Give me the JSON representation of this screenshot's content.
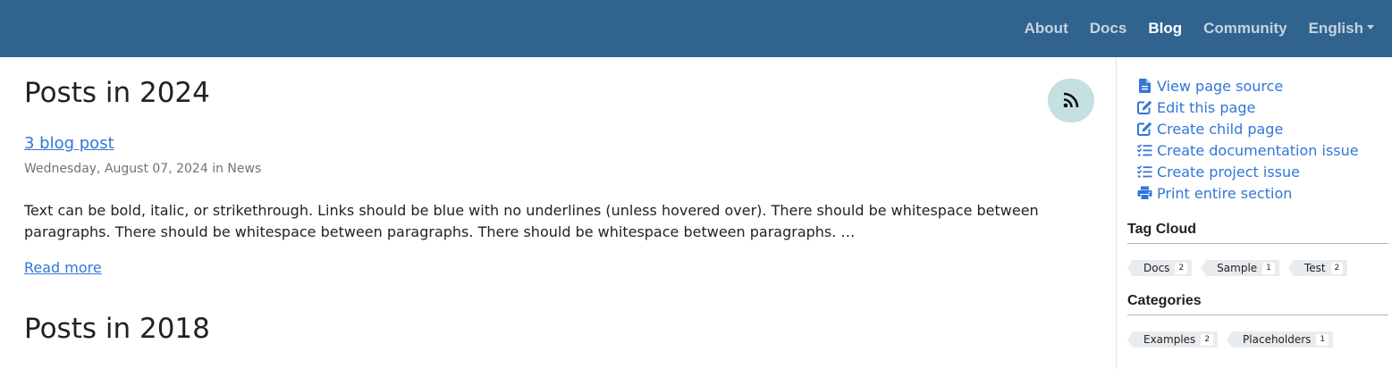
{
  "navbar": {
    "links": [
      {
        "label": "About",
        "active": false
      },
      {
        "label": "Docs",
        "active": false
      },
      {
        "label": "Blog",
        "active": true
      },
      {
        "label": "Community",
        "active": false
      }
    ],
    "language": "English"
  },
  "main": {
    "section_2024_title": "Posts in 2024",
    "post": {
      "title": "3 blog post",
      "meta": "Wednesday, August 07, 2024 in News",
      "excerpt": "Text can be bold, italic, or strikethrough. Links should be blue with no underlines (unless hovered over). There should be whitespace between paragraphs. There should be whitespace between paragraphs. There should be whitespace between paragraphs. …",
      "read_more": "Read more"
    },
    "section_2018_title": "Posts in 2018",
    "rss_icon": "rss-icon"
  },
  "sidebar": {
    "page_meta": [
      {
        "label": "View page source",
        "icon": "file-icon"
      },
      {
        "label": "Edit this page",
        "icon": "edit-icon"
      },
      {
        "label": "Create child page",
        "icon": "edit-icon"
      },
      {
        "label": "Create documentation issue",
        "icon": "tasks-icon"
      },
      {
        "label": "Create project issue",
        "icon": "tasks-icon"
      },
      {
        "label": "Print entire section",
        "icon": "print-icon"
      }
    ],
    "tag_cloud_title": "Tag Cloud",
    "tags": [
      {
        "label": "Docs",
        "count": "2"
      },
      {
        "label": "Sample",
        "count": "1"
      },
      {
        "label": "Test",
        "count": "2"
      }
    ],
    "categories_title": "Categories",
    "categories": [
      {
        "label": "Examples",
        "count": "2"
      },
      {
        "label": "Placeholders",
        "count": "1"
      }
    ]
  },
  "colors": {
    "navbar": "#30638e",
    "link": "#3176d9",
    "rss_bg": "#c4e0e0"
  }
}
